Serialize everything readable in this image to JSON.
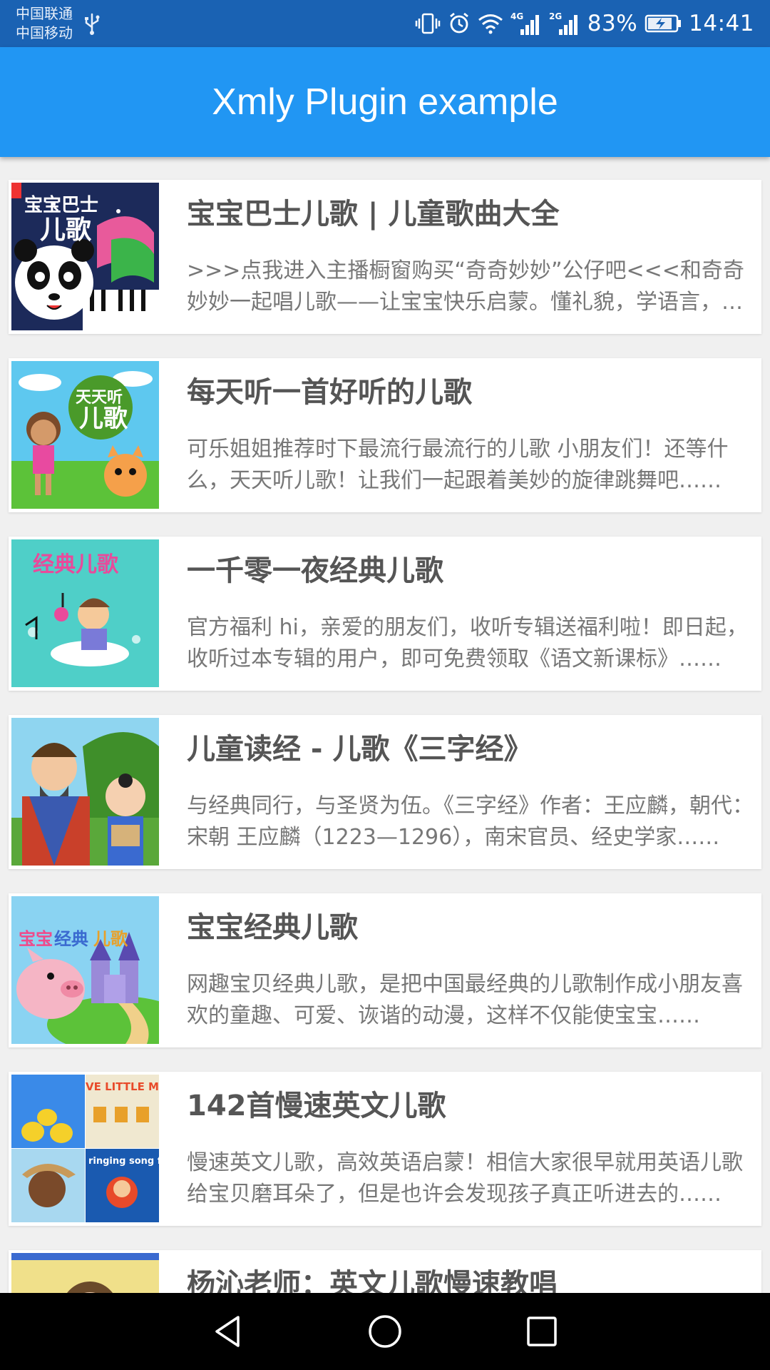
{
  "status_bar": {
    "carrier_1": "中国联通",
    "carrier_2": "中国移动",
    "network_4g": "4G",
    "network_2g": "2G",
    "battery": "83%",
    "time": "14:41",
    "icons": [
      "usb-icon",
      "vibrate-icon",
      "alarm-icon",
      "wifi-icon",
      "signal-icon",
      "battery-charging-icon"
    ]
  },
  "app_bar": {
    "title": "Xmly Plugin example",
    "color": "#2196f3"
  },
  "albums": [
    {
      "title": "宝宝巴士儿歌 | 儿童歌曲大全",
      "description": ">>>点我进入主播橱窗购买“奇奇妙妙”公仔吧<<<和奇奇妙妙一起唱儿歌——让宝宝快乐启蒙。懂礼貌，学语言，认知世界，习惯养成……",
      "cover_text": "宝宝巴士儿歌"
    },
    {
      "title": "每天听一首好听的儿歌",
      "description": "可乐姐姐推荐时下最流行最流行的儿歌 小朋友们！还等什么，天天听儿歌！让我们一起跟着美妙的旋律跳舞吧……",
      "cover_text": "天天听儿歌"
    },
    {
      "title": "一千零一夜经典儿歌",
      "description": "官方福利  hi，亲爱的朋友们，收听专辑送福利啦！即日起，收听过本专辑的用户，即可免费领取《语文新课标》……",
      "cover_text": "经典儿歌"
    },
    {
      "title": "儿童读经 - 儿歌《三字经》",
      "description": "与经典同行，与圣贤为伍。《三字经》作者：王应麟，朝代：宋朝 王应麟（1223—1296），南宋官员、经史学家……",
      "cover_text": ""
    },
    {
      "title": "宝宝经典儿歌",
      "description": "网趣宝贝经典儿歌，是把中国最经典的儿歌制作成小朋友喜欢的童趣、可爱、诙谐的动漫，这样不仅能使宝宝……",
      "cover_text": "宝宝经典儿歌"
    },
    {
      "title": "142首慢速英文儿歌",
      "description": "慢速英文儿歌，高效英语启蒙！相信大家很早就用英语儿歌给宝贝磨耳朵了，但是也许会发现孩子真正听进去的……",
      "cover_text": "VE LITTLE MON"
    },
    {
      "title": "杨沁老师：英文儿歌慢速教唱",
      "description": "",
      "cover_text": ""
    }
  ],
  "nav_bar": {
    "icons": [
      "back-icon",
      "home-icon",
      "recents-icon"
    ]
  }
}
